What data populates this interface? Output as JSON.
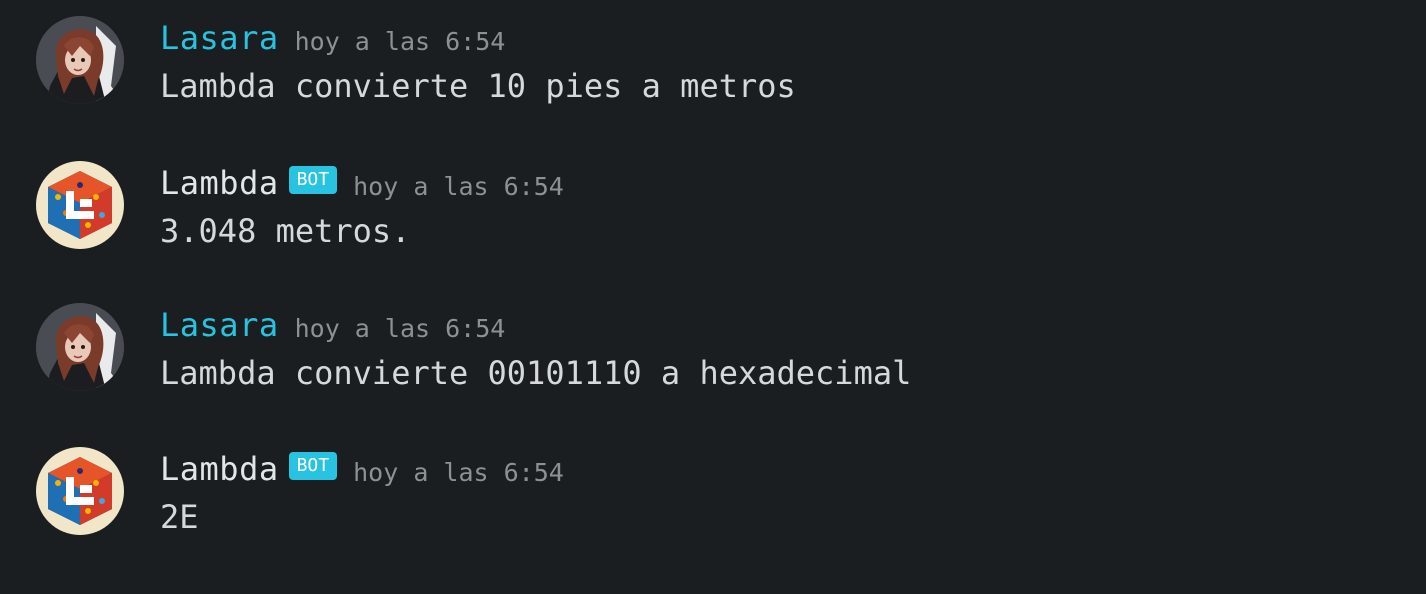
{
  "colors": {
    "background": "#1b1e20",
    "user_name": "#27c3e0",
    "bot_name": "#e3e6e8",
    "badge": "#27c3e0",
    "timestamp": "#8c9196",
    "text": "#d6d9dc"
  },
  "messages": [
    {
      "author": "Lasara",
      "is_bot": false,
      "avatar_icon": "anime-girl-avatar",
      "timestamp": "hoy a las 6:54",
      "text": "Lambda convierte 10 pies a metros"
    },
    {
      "author": "Lambda",
      "is_bot": true,
      "badge": "BOT",
      "avatar_icon": "lambda-cube-avatar",
      "timestamp": "hoy a las 6:54",
      "text": "3.048 metros."
    },
    {
      "author": "Lasara",
      "is_bot": false,
      "avatar_icon": "anime-girl-avatar",
      "timestamp": "hoy a las 6:54",
      "text": "Lambda convierte 00101110 a hexadecimal"
    },
    {
      "author": "Lambda",
      "is_bot": true,
      "badge": "BOT",
      "avatar_icon": "lambda-cube-avatar",
      "timestamp": "hoy a las 6:54",
      "text": "2E"
    }
  ]
}
